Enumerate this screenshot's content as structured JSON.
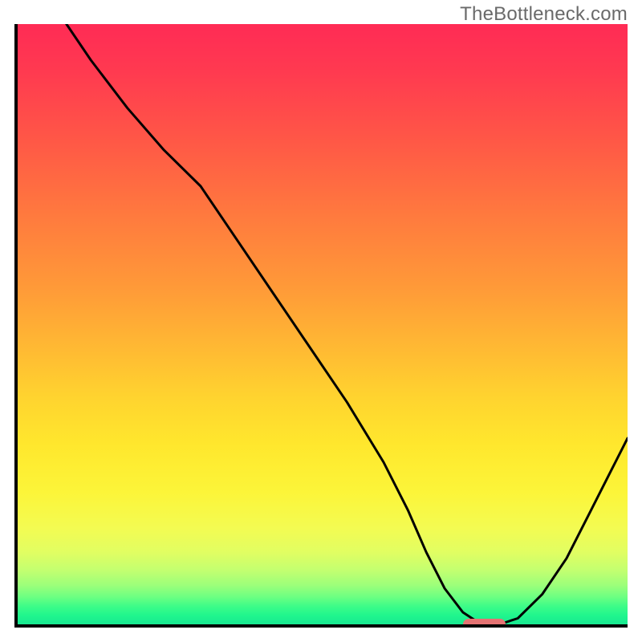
{
  "watermark": "TheBottleneck.com",
  "plot": {
    "inner_w": 760,
    "inner_h": 748
  },
  "chart_data": {
    "type": "line",
    "title": "",
    "xlabel": "",
    "ylabel": "",
    "xlim": [
      0,
      100
    ],
    "ylim": [
      0,
      100
    ],
    "x": [
      8,
      12,
      18,
      24,
      30,
      36,
      42,
      48,
      54,
      60,
      64,
      67,
      70,
      73,
      76,
      79,
      82,
      86,
      90,
      94,
      98,
      100
    ],
    "values": [
      100,
      94,
      86,
      79,
      73,
      64,
      55,
      46,
      37,
      27,
      19,
      12,
      6,
      2,
      0,
      0,
      1,
      5,
      11,
      19,
      27,
      31
    ],
    "marker": {
      "x_start": 73,
      "x_end": 80,
      "y": 0
    },
    "gradient_stops": [
      {
        "pos": 0,
        "color": "#ff2b55"
      },
      {
        "pos": 20,
        "color": "#ff7a3e"
      },
      {
        "pos": 44,
        "color": "#ff9a38"
      },
      {
        "pos": 70,
        "color": "#ffe72d"
      },
      {
        "pos": 88,
        "color": "#e1fe62"
      },
      {
        "pos": 97,
        "color": "#3dfc88"
      },
      {
        "pos": 100,
        "color": "#18e891"
      }
    ]
  }
}
